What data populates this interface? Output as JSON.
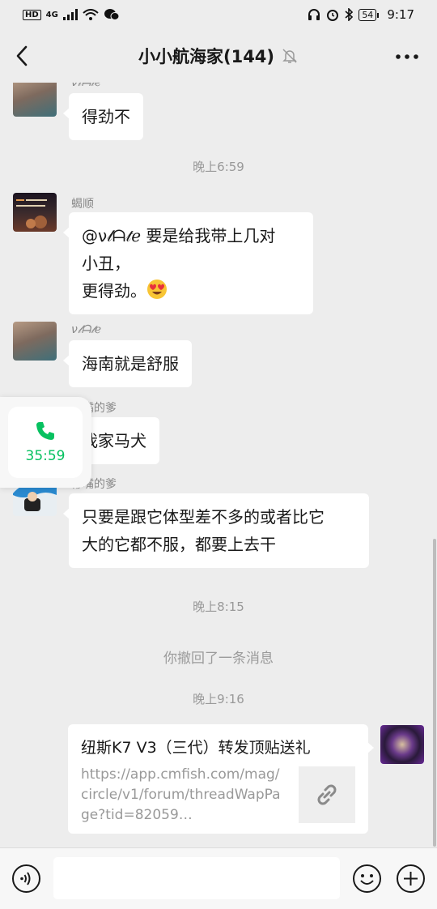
{
  "status_bar": {
    "left_badges": [
      "HD",
      "4G"
    ],
    "battery": "54",
    "time": "9:17"
  },
  "header": {
    "title": "小小航海家(144)",
    "icons": [
      "back-chevron-icon",
      "mute-bell-icon",
      "more-dots-icon"
    ]
  },
  "messages": [
    {
      "sender": "ν𝓁ᗩ𝓉ℯ",
      "text": "得劲不"
    },
    {
      "time": "晚上6:59"
    },
    {
      "sender": "蝎顺",
      "text_lines": [
        "@ν𝓁ᗩ𝓉ℯ 要是给我带上几对",
        "小丑，",
        "更得劲。"
      ],
      "emoji": "heart-eyes-emoji"
    },
    {
      "sender": "ν𝓁ᗩ𝓉ℯ",
      "text": "海南就是舒服"
    },
    {
      "sender": "彬嘴的爹",
      "text": "我家马犬"
    },
    {
      "sender": "彬嘴的爹",
      "text_lines": [
        "只要是跟它体型差不多的或者比它",
        "大的它都不服，都要上去干"
      ]
    },
    {
      "time": "晚上8:15"
    },
    {
      "system": "你撤回了一条消息"
    },
    {
      "time": "晚上9:16"
    }
  ],
  "link_card": {
    "title": "纽斯K7 V3（三代）转发顶贴送礼",
    "url": "https://app.cmfish.com/mag/circle/v1/forum/threadWapPage?tid=82059…",
    "thumb_icon": "link-icon"
  },
  "call_float": {
    "duration": "35:59",
    "icon": "phone-icon",
    "color": "#07c160"
  },
  "input_bar": {
    "icons": [
      "voice-icon",
      "emoji-icon",
      "plus-icon"
    ]
  }
}
